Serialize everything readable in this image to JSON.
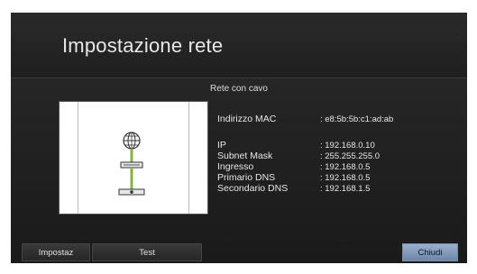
{
  "header": {
    "title": "Impostazione rete"
  },
  "connection": {
    "type_label": "Rete con cavo"
  },
  "info": {
    "mac": {
      "label": "Indirizzo MAC",
      "value": ": e8:5b:5b:c1:ad:ab"
    },
    "rows": [
      {
        "label": "IP",
        "value": ": 192.168.0.10"
      },
      {
        "label": "Subnet Mask",
        "value": ": 255.255.255.0"
      },
      {
        "label": "Ingresso",
        "value": ": 192.168.0.5"
      },
      {
        "label": "Primario DNS",
        "value": ": 192.168.0.5"
      },
      {
        "label": "Secondario DNS",
        "value": ": 192.168.1.5"
      }
    ]
  },
  "buttons": {
    "settings": "Impostaz",
    "test": "Test",
    "close": "Chiudi"
  },
  "colors": {
    "accent_button": "#8aa2c2",
    "background": "#1c1c1c"
  },
  "icons": {
    "globe": "globe-icon",
    "router": "router-icon",
    "device": "device-icon"
  }
}
